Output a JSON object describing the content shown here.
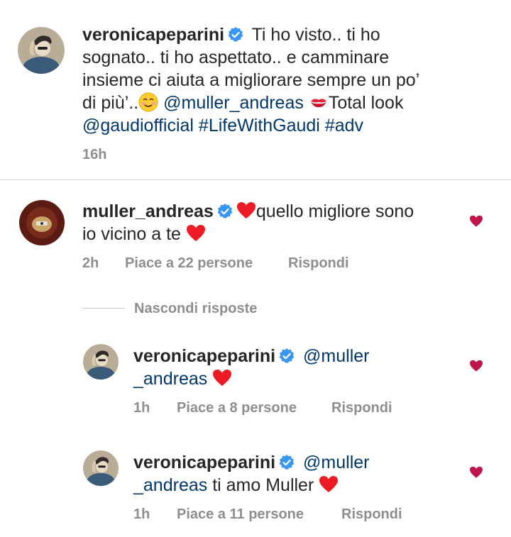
{
  "caption": {
    "username": "veronicapeparini",
    "line1": "Ti ho visto.. ti ho",
    "line2": "sognato.. ti ho aspettato.. e camminare",
    "line3": "insieme ci aiuta a migliorare sempre un po’",
    "line4_text": "di più’..",
    "mention": "@muller_andreas",
    "line4_tail": "Total look",
    "line5_mention": "@gaudiofficial",
    "hashtag1": "#LifeWithGaudi",
    "hashtag2": "#adv",
    "time": "16h"
  },
  "comments": [
    {
      "username": "muller_andreas",
      "line1": "quello migliore sono",
      "line2": "io vicino a te",
      "time": "2h",
      "likes": "Piace a 22 persone",
      "reply": "Rispondi"
    }
  ],
  "hide_replies": "Nascondi risposte",
  "replies": [
    {
      "username": "veronicapeparini",
      "mention_part1": "@muller",
      "mention_part2": "_andreas",
      "text": "",
      "time": "1h",
      "likes": "Piace a 8 persone",
      "reply": "Rispondi"
    },
    {
      "username": "veronicapeparini",
      "mention_part1": "@muller",
      "mention_part2": "_andreas",
      "text": " ti amo Muller",
      "time": "1h",
      "likes": "Piace a 11 persone",
      "reply": "Rispondi"
    }
  ],
  "colors": {
    "verified": "#3897f0",
    "heart": "#ed1c24",
    "like_heart": "#c0174b",
    "link": "#00376b",
    "meta": "#8e8e8e"
  },
  "icons": [
    "verified-badge-icon",
    "red-heart-emoji-icon",
    "kiss-mark-emoji-icon",
    "smiling-face-emoji-icon",
    "like-heart-icon"
  ]
}
